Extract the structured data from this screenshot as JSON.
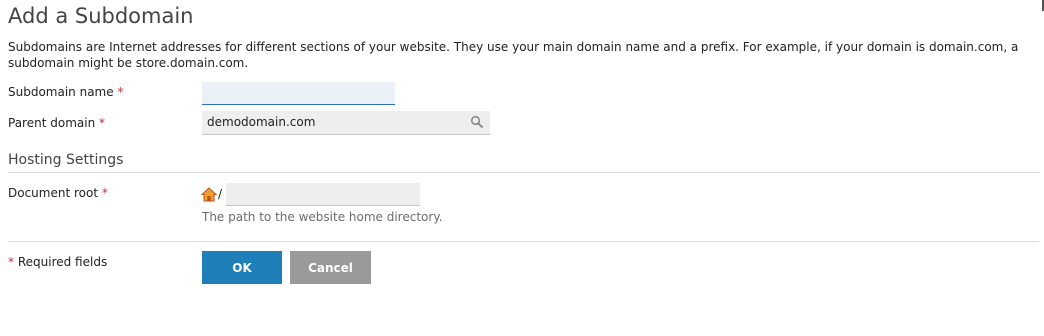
{
  "page": {
    "title": "Add a Subdomain",
    "description": "Subdomains are Internet addresses for different sections of your website. They use your main domain name and a prefix. For example, if your domain is domain.com, a subdomain might be store.domain.com."
  },
  "form": {
    "subdomain_label": "Subdomain name",
    "subdomain_value": "",
    "parent_label": "Parent domain",
    "parent_value": "demodomain.com",
    "required_marker": "*"
  },
  "hosting": {
    "section_title": "Hosting Settings",
    "docroot_label": "Document root",
    "path_separator": "/",
    "docroot_value": "",
    "docroot_hint": "The path to the website home directory."
  },
  "footer": {
    "required_note": "Required fields",
    "ok_label": "OK",
    "cancel_label": "Cancel"
  },
  "icons": {
    "parent_search": "search-icon",
    "docroot_home": "home-icon"
  },
  "colors": {
    "primary_button": "#1e7fb9",
    "cancel_button": "#9a9a9a",
    "required": "#c03030",
    "input_focus": "#2c6fb4"
  }
}
